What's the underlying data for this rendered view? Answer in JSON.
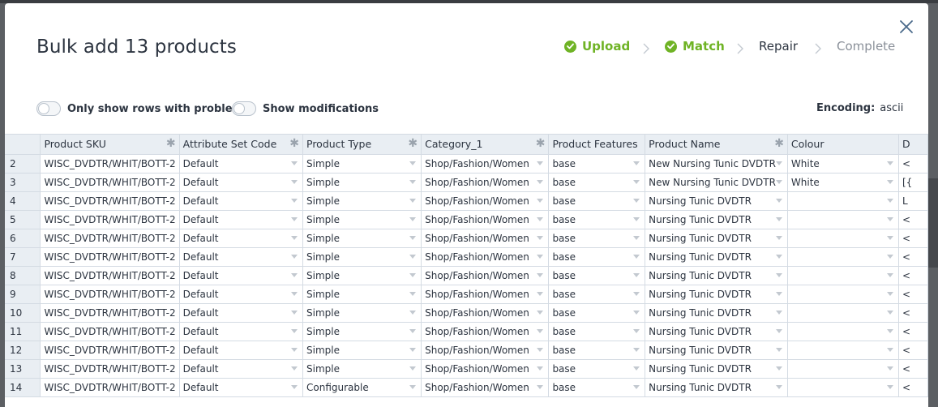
{
  "modal": {
    "title": "Bulk add 13 products"
  },
  "steps": [
    {
      "label": "Upload",
      "state": "done"
    },
    {
      "label": "Match",
      "state": "done"
    },
    {
      "label": "Repair",
      "state": "current"
    },
    {
      "label": "Complete",
      "state": "pending"
    }
  ],
  "toggles": {
    "problems_label": "Only show rows with problems",
    "modifications_label": "Show modifications"
  },
  "encoding": {
    "label": "Encoding:",
    "value": "ascii"
  },
  "colors": {
    "success": "#6fb325",
    "text": "#2c3440",
    "header_bg": "#e9eef3",
    "border": "#d4dbe3"
  },
  "grid": {
    "columns": [
      {
        "label": "",
        "required": false
      },
      {
        "label": "Product SKU",
        "required": true
      },
      {
        "label": "Attribute Set Code",
        "required": true
      },
      {
        "label": "Product Type",
        "required": true
      },
      {
        "label": "Category_1",
        "required": true
      },
      {
        "label": "Product Features",
        "required": false
      },
      {
        "label": "Product Name",
        "required": true
      },
      {
        "label": "Colour",
        "required": false
      },
      {
        "label": "D",
        "required": false
      }
    ],
    "rows": [
      {
        "num": "2",
        "sku": "WISC_DVDTR/WHIT/BOTT-2",
        "attr": "Default",
        "type": "Simple",
        "cat": "Shop/Fashion/Women",
        "feat": "base",
        "name": "New Nursing Tunic DVDTR",
        "colour": "White",
        "d": "<"
      },
      {
        "num": "3",
        "sku": "WISC_DVDTR/WHIT/BOTT-2",
        "attr": "Default",
        "type": "Simple",
        "cat": "Shop/Fashion/Women",
        "feat": "base",
        "name": "New Nursing Tunic DVDTR",
        "colour": "White",
        "d": "[{"
      },
      {
        "num": "4",
        "sku": "WISC_DVDTR/WHIT/BOTT-2",
        "attr": "Default",
        "type": "Simple",
        "cat": "Shop/Fashion/Women",
        "feat": "base",
        "name": "Nursing Tunic DVDTR",
        "colour": "",
        "d": "L"
      },
      {
        "num": "5",
        "sku": "WISC_DVDTR/WHIT/BOTT-2",
        "attr": "Default",
        "type": "Simple",
        "cat": "Shop/Fashion/Women",
        "feat": "base",
        "name": "Nursing Tunic DVDTR",
        "colour": "",
        "d": "<"
      },
      {
        "num": "6",
        "sku": "WISC_DVDTR/WHIT/BOTT-2",
        "attr": "Default",
        "type": "Simple",
        "cat": "Shop/Fashion/Women",
        "feat": "base",
        "name": "Nursing Tunic DVDTR",
        "colour": "",
        "d": "<"
      },
      {
        "num": "7",
        "sku": "WISC_DVDTR/WHIT/BOTT-2",
        "attr": "Default",
        "type": "Simple",
        "cat": "Shop/Fashion/Women",
        "feat": "base",
        "name": "Nursing Tunic DVDTR",
        "colour": "",
        "d": "<"
      },
      {
        "num": "8",
        "sku": "WISC_DVDTR/WHIT/BOTT-2",
        "attr": "Default",
        "type": "Simple",
        "cat": "Shop/Fashion/Women",
        "feat": "base",
        "name": "Nursing Tunic DVDTR",
        "colour": "",
        "d": "<"
      },
      {
        "num": "9",
        "sku": "WISC_DVDTR/WHIT/BOTT-2",
        "attr": "Default",
        "type": "Simple",
        "cat": "Shop/Fashion/Women",
        "feat": "base",
        "name": "Nursing Tunic DVDTR",
        "colour": "",
        "d": "<"
      },
      {
        "num": "10",
        "sku": "WISC_DVDTR/WHIT/BOTT-2",
        "attr": "Default",
        "type": "Simple",
        "cat": "Shop/Fashion/Women",
        "feat": "base",
        "name": "Nursing Tunic DVDTR",
        "colour": "",
        "d": "<"
      },
      {
        "num": "11",
        "sku": "WISC_DVDTR/WHIT/BOTT-2",
        "attr": "Default",
        "type": "Simple",
        "cat": "Shop/Fashion/Women",
        "feat": "base",
        "name": "Nursing Tunic DVDTR",
        "colour": "",
        "d": "<"
      },
      {
        "num": "12",
        "sku": "WISC_DVDTR/WHIT/BOTT-2",
        "attr": "Default",
        "type": "Simple",
        "cat": "Shop/Fashion/Women",
        "feat": "base",
        "name": "Nursing Tunic DVDTR",
        "colour": "",
        "d": "<"
      },
      {
        "num": "13",
        "sku": "WISC_DVDTR/WHIT/BOTT-2",
        "attr": "Default",
        "type": "Simple",
        "cat": "Shop/Fashion/Women",
        "feat": "base",
        "name": "Nursing Tunic DVDTR",
        "colour": "",
        "d": "<"
      },
      {
        "num": "14",
        "sku": "WISC_DVDTR/WHIT/BOTT-2",
        "attr": "Default",
        "type": "Configurable",
        "cat": "Shop/Fashion/Women",
        "feat": "base",
        "name": "Nursing Tunic DVDTR",
        "colour": "",
        "d": "<"
      }
    ]
  }
}
